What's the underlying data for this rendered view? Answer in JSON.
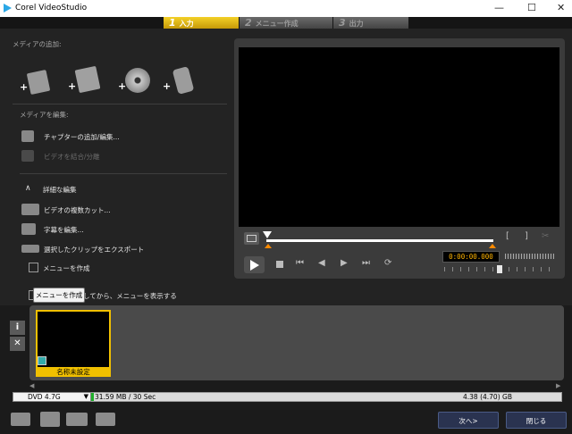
{
  "window": {
    "title": "Corel VideoStudio"
  },
  "steps": [
    {
      "num": "1",
      "label": "入力"
    },
    {
      "num": "2",
      "label": "メニュー作成"
    },
    {
      "num": "3",
      "label": "出力"
    }
  ],
  "left": {
    "add_media_title": "メディアの追加:",
    "edit_media_title": "メディアを編集:",
    "add_chapter": "チャプターの追加/編集...",
    "combine_split": "ビデオを結合/分離",
    "advanced_edit": "詳細な編集",
    "multi_cut": "ビデオの複数カット...",
    "subtitle_edit": "字幕を編集...",
    "export_clip": "選択したクリップをエクスポート",
    "create_menu": "メニューを作成",
    "play_then_menu": "ビデオを再生してから、メニューを表示する"
  },
  "tooltip": "メニューを作成",
  "player": {
    "timecode": "0:00:00.000"
  },
  "thumbnail": {
    "label": "名称未設定"
  },
  "disk": {
    "selected": "DVD 4.7G",
    "usage": "31.59 MB / 30 Sec",
    "capacity": "4.38 (4.70) GB"
  },
  "buttons": {
    "next": "次へ>",
    "close": "閉じる"
  }
}
